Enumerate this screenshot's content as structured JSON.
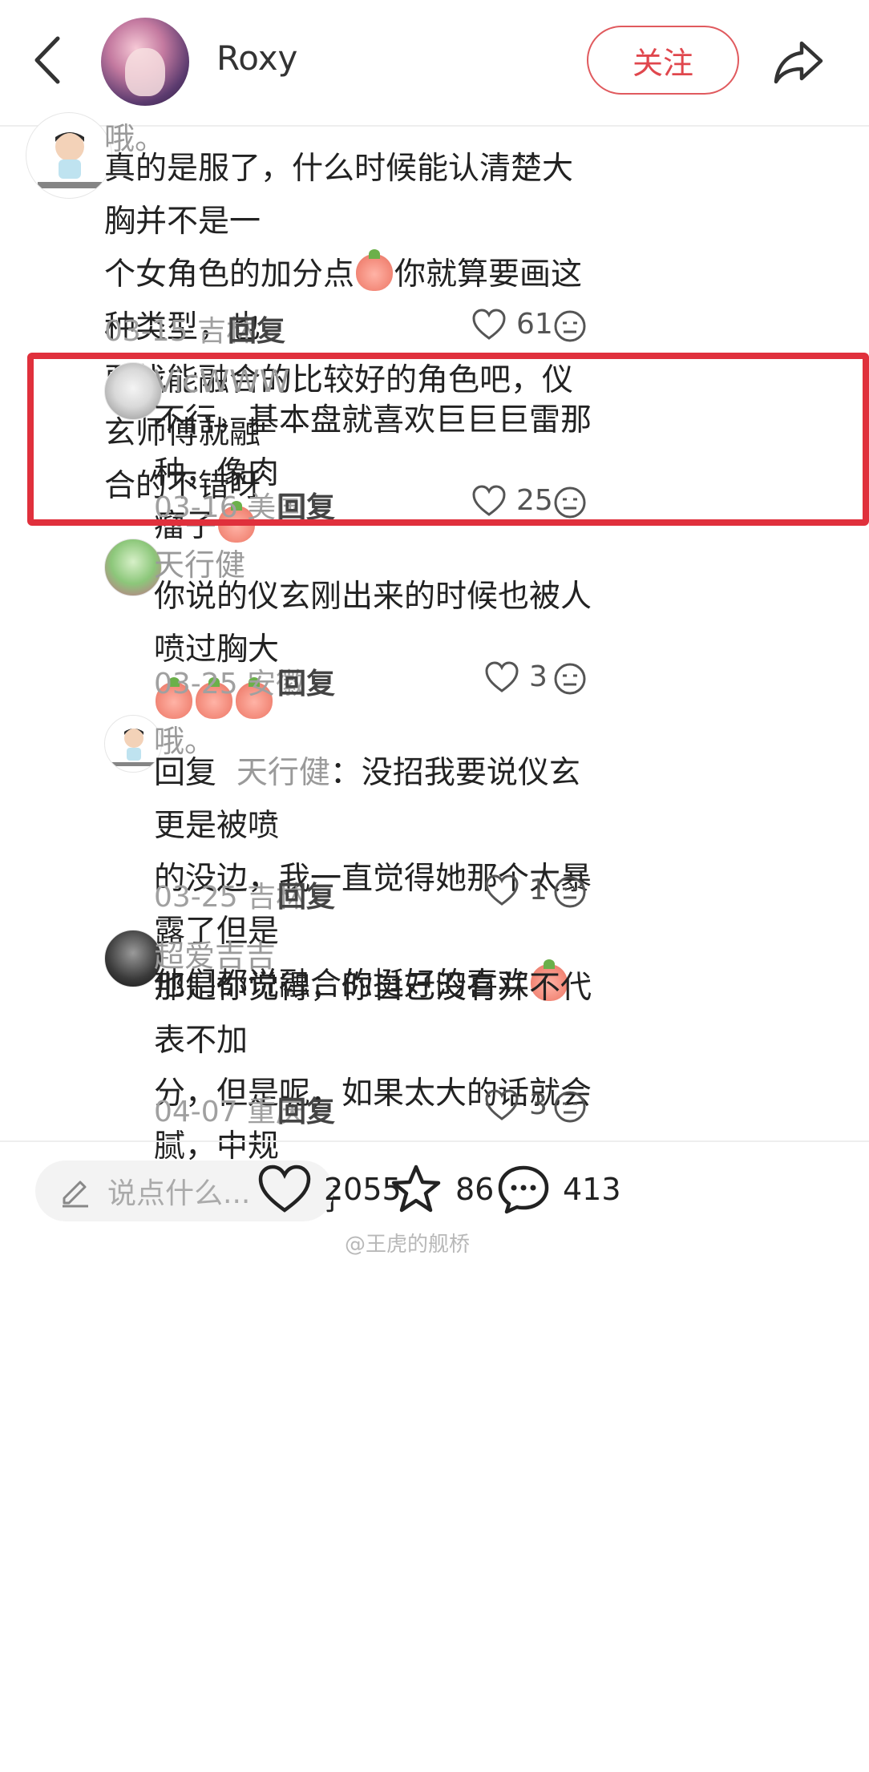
{
  "header": {
    "username": "Roxy",
    "follow_label": "关注"
  },
  "comments": [
    {
      "user": "哦。",
      "text_lines": [
        "真的是服了，什么时候能认清楚大胸并不是一",
        "个女角色的加分点",
        "你就算要画这种类型，也",
        "要找能融合的比较好的角色吧，仪玄师傅就融",
        "合的不错呀"
      ],
      "date": "03-15",
      "location": "吉林",
      "reply_label": "回复",
      "likes": "61"
    },
    {
      "user": "VicWWW",
      "text_a": "不行，基本盘就喜欢巨巨巨雷那种，像肉",
      "text_b": "瘤子",
      "date": "03-16",
      "location": "美国",
      "reply_label": "回复",
      "likes": "25"
    },
    {
      "user": "天行健",
      "text_a": "你说的仪玄刚出来的时候也被人喷过胸大",
      "date": "03-25",
      "location": "安徽",
      "reply_label": "回复",
      "likes": "3"
    },
    {
      "user": "哦。",
      "reply_prefix": "回复",
      "mention": "天行健",
      "text_a": "：没招我要说仪玄更是被喷",
      "text_b": "的没边，我一直觉得她那个太暴露了但是",
      "text_c": "他们都说融合的挺好的喜欢",
      "date": "03-25",
      "location": "吉林",
      "reply_label": "回复",
      "likes": "1"
    },
    {
      "user": "超爱吉吉",
      "text_a": "那是你觉得，你自己没有并不代表不加",
      "text_b": "分，但是呢，如果太大的话就会腻，中规",
      "text_c": "中矩的就挺好",
      "date": "04-07",
      "location": "重庆",
      "reply_label": "回复",
      "likes": "3"
    }
  ],
  "bottom_bar": {
    "input_placeholder": "说点什么...",
    "likes": "2055",
    "favorites": "86",
    "comments": "413"
  },
  "watermark": "@王虎的舰桥",
  "colors": {
    "accent": "#e0474d",
    "highlight_border": "#e0303c",
    "muted_text": "#9a9a9a"
  }
}
